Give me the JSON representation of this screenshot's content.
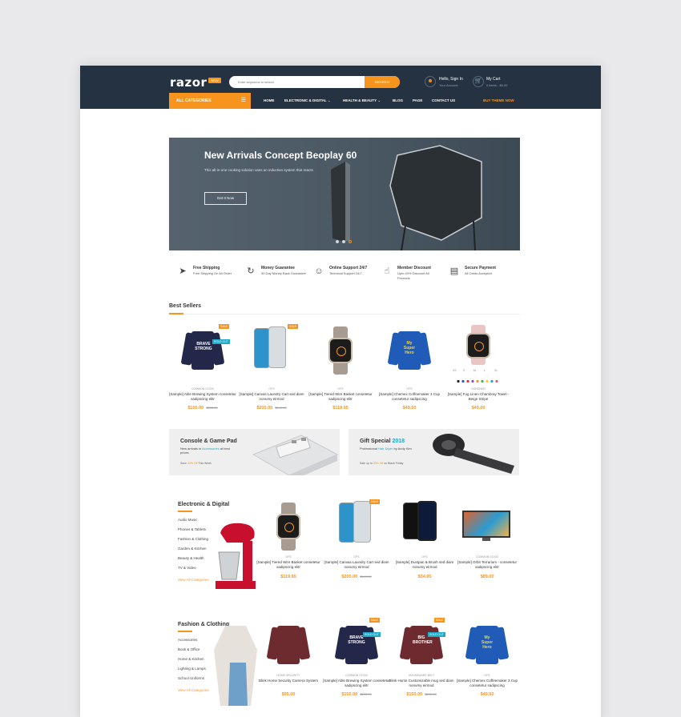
{
  "header": {
    "logo": "razor",
    "logo_badge": "NEW",
    "search_placeholder": "Enter keywords to search",
    "search_button": "SEARCH",
    "account_line1": "Hello, Sign In",
    "account_line2": "Your Account",
    "cart_line1": "My Cart",
    "cart_line2": "0 items - $0.00"
  },
  "nav": {
    "all_categories": "ALL CATEGORIES",
    "items": [
      "HOME",
      "ELECTRONIC & DIGITAL ⌄",
      "HEALTH & BEAUTY ⌄",
      "BLOG",
      "PAGE",
      "CONTACT US"
    ],
    "buy": "BUY THEME NOW"
  },
  "hero": {
    "title": "New Arrivals Concept Beoplay 60",
    "subtitle": "This all-in-one cooking solution uses an induction system that reacts",
    "button": "Get It Now"
  },
  "features": [
    {
      "icon": "rocket-icon",
      "title": "Free Shipping",
      "desc": "Free Shipping On All Order"
    },
    {
      "icon": "refresh-icon",
      "title": "Money Guarantee",
      "desc": "30 Day Money Back Guarantee"
    },
    {
      "icon": "support-icon",
      "title": "Online Support 24/7",
      "desc": "Technical Support 24/7"
    },
    {
      "icon": "thumbs-up-icon",
      "title": "Member Discount",
      "desc": "Upto 40% Discount All Products"
    },
    {
      "icon": "card-icon",
      "title": "Secure Payment",
      "desc": "All Cards Accepted"
    }
  ],
  "best_sellers": {
    "title": "Best Sellers",
    "products": [
      {
        "brand": "COMMON GOOD",
        "name": "[Sample] Able Brewing System consetetur sadipscing elitr",
        "price": "$100.00",
        "old": "$225.00",
        "badge": "SALE",
        "badge2": "SOLD OUT"
      },
      {
        "brand": "OFS",
        "name": "[Sample] Canvas Laundry Cart sed diam nonumy eirmod",
        "price": "$200.00",
        "old": "$249.00",
        "badge": "SALE"
      },
      {
        "brand": "OFS",
        "name": "[Sample] Tiered Wire Basket consetetur sadipscing elitr",
        "price": "$119.95",
        "old": ""
      },
      {
        "brand": "OFS",
        "name": "[Sample] Chemex Coffeemaker 3 Cup consetetur sadipscing",
        "price": "$49.50",
        "old": ""
      },
      {
        "brand": "GARDNER",
        "name": "[Sample] Fog Linen Chambray Towel - Beige Stripe",
        "price": "$49.00",
        "old": "",
        "sizes": [
          "XS",
          "S",
          "M",
          "L",
          "XL"
        ]
      }
    ]
  },
  "banners": [
    {
      "title": "Console & Game Pad",
      "desc_pre": "New arrivals in ",
      "desc_hl": "Accessories",
      "desc_post": " at best prices",
      "small_pre": "Save ",
      "small_hl": "40% Off",
      "small_post": " This Week"
    },
    {
      "title_pre": "Gift Special ",
      "title_hl": "2018",
      "desc_pre": "Professional ",
      "desc_hl": "Hair Dryer",
      "desc_post": " by Andy Kim",
      "small_pre": "Sale up to ",
      "small_hl": "20% Off",
      "small_post": " on Black Friday"
    }
  ],
  "electronic": {
    "title": "Electronic & Digital",
    "items": [
      "Audio Music",
      "Phones & Tablets",
      "Fashion & Clothing",
      "Garden & Kitchen",
      "Beauty & Health",
      "TV & Video"
    ],
    "view_all": "View All Categories",
    "products": [
      {
        "brand": "OFS",
        "name": "[Sample] Tiered Wire Basket consetetur sadipscing elitr",
        "price": "$119.95",
        "old": ""
      },
      {
        "brand": "OFS",
        "name": "[Sample] Canvas Laundry Cart sed diam nonumy eirmod",
        "price": "$200.00",
        "old": "$249.00",
        "badge": "SALE"
      },
      {
        "brand": "OFS",
        "name": "[Sample] Dustpan & Brush sed diam nonumy eirmod",
        "price": "$34.95",
        "old": ""
      },
      {
        "brand": "COMMON GOOD",
        "name": "[Sample] Orbit Terrarium - consetetur sadipscing elitr",
        "price": "$89.00",
        "old": ""
      }
    ]
  },
  "fashion": {
    "title": "Fashion & Clothing",
    "items": [
      "Accessories",
      "Book & Office",
      "Home & Kitchen",
      "Lighting & Lamps",
      "School Uniforms"
    ],
    "view_all": "View All Categories",
    "products": [
      {
        "brand": "HOME SECURITY",
        "name": "Blink Home Security Camera System",
        "price": "$95.00",
        "old": ""
      },
      {
        "brand": "COMMON GOOD",
        "name": "[Sample] Able Brewing System consetetur sadipscing elitr",
        "price": "$150.00",
        "old": "$225.00",
        "badge": "SALE",
        "badge2": "SOLD OUT"
      },
      {
        "brand": "HOUSEWARE BELT",
        "name": "Blink Home Customizable mug sed diam nonumy eirmod",
        "price": "$150.00",
        "old": "$200.00",
        "badge": "SALE",
        "badge2": "SOLD OUT"
      },
      {
        "brand": "OFS",
        "name": "[Sample] Chemex Coffeemaker 3 Cup consetetur sadipscing",
        "price": "$49.50",
        "old": ""
      }
    ]
  },
  "colors": {
    "accent": "#f7941d",
    "header": "#253242",
    "teal": "#20a8c6"
  }
}
